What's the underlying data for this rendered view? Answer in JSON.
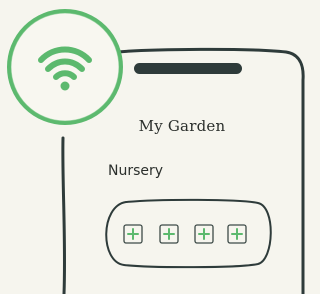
{
  "screen": {
    "title": "My Garden",
    "section_label": "Nursery"
  },
  "nursery": {
    "slots": [
      {
        "icon": "plus-icon"
      },
      {
        "icon": "plus-icon"
      },
      {
        "icon": "plus-icon"
      },
      {
        "icon": "plus-icon"
      }
    ]
  },
  "badge": {
    "icon": "wifi-icon"
  },
  "colors": {
    "background": "#f6f5ee",
    "ink": "#2e3b3a",
    "accent_green": "#5cb96e"
  }
}
